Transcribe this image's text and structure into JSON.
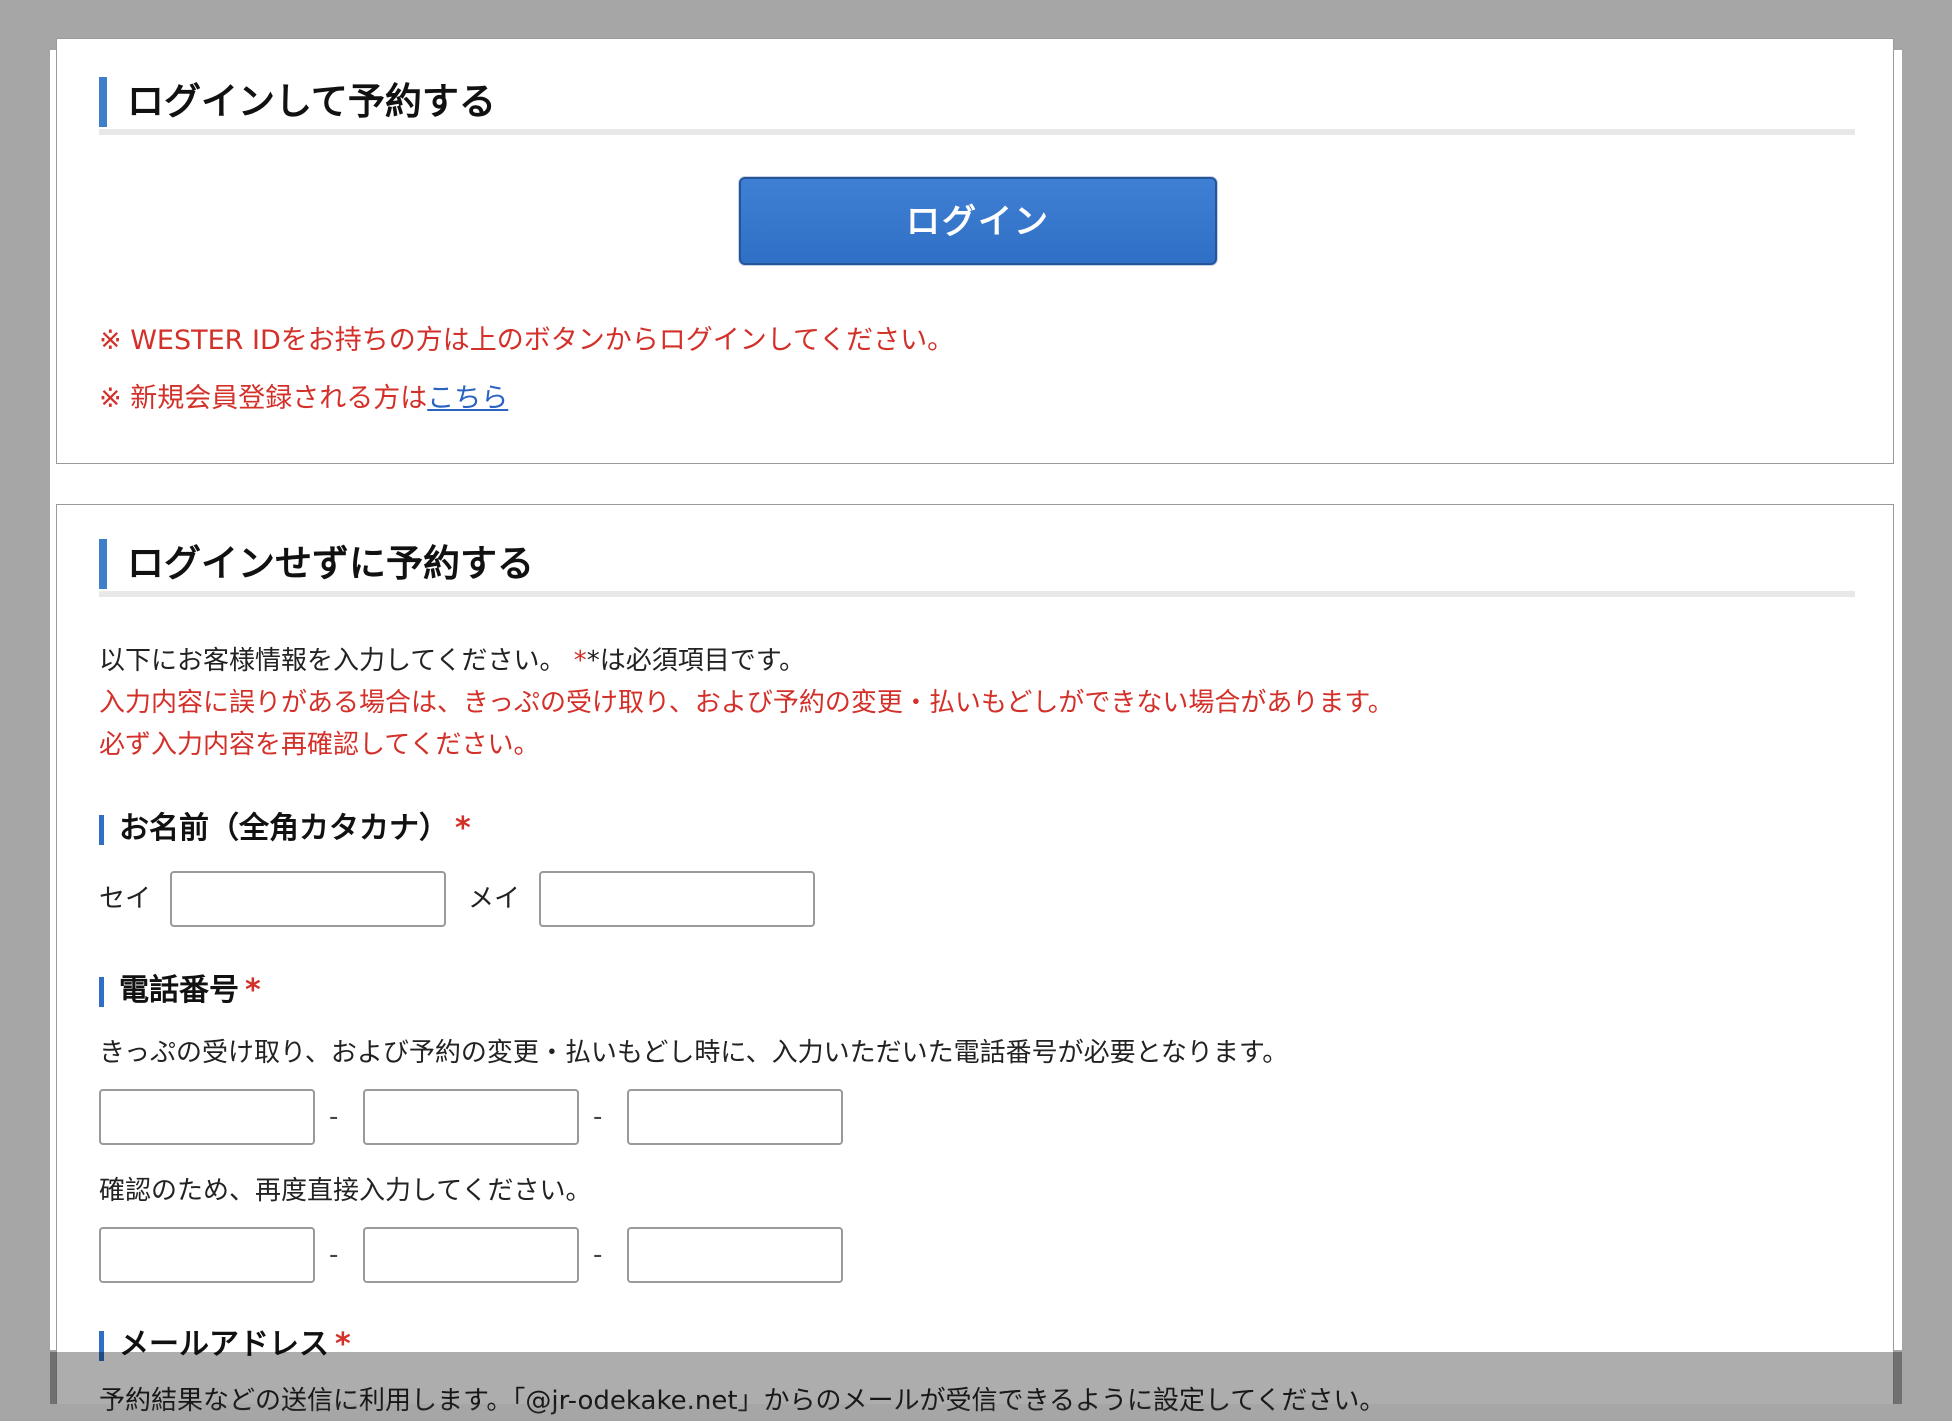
{
  "login_section": {
    "title": "ログインして予約する",
    "login_button": "ログイン",
    "note1": "※ WESTER IDをお持ちの方は上のボタンからログインしてください。",
    "note2_prefix": "※ 新規会員登録される方は",
    "note2_link": "こちら"
  },
  "guest_section": {
    "title": "ログインせずに予約する",
    "intro_line1": "以下にお客様情報を入力してください。",
    "intro_required": "*は必須項目です。",
    "warning_line1": "入力内容に誤りがある場合は、きっぷの受け取り、および予約の変更・払いもどしができない場合があります。",
    "warning_line2": "必ず入力内容を再確認してください。",
    "name_field": {
      "label": "お名前（全角カタカナ）",
      "required_mark": "*",
      "sei_label": "セイ",
      "mei_label": "メイ",
      "sei_value": "",
      "mei_value": ""
    },
    "phone_field": {
      "label": "電話番号",
      "required_mark": "*",
      "description": "きっぷの受け取り、および予約の変更・払いもどし時に、入力いただいた電話番号が必要となります。",
      "separator": "-",
      "confirm_description": "確認のため、再度直接入力してください。",
      "values": [
        "",
        "",
        ""
      ],
      "confirm_values": [
        "",
        "",
        ""
      ]
    },
    "email_field": {
      "label": "メールアドレス",
      "required_mark": "*",
      "description": "予約結果などの送信に利用します。「@jr-odekake.net」からのメールが受信できるように設定してください。"
    }
  }
}
